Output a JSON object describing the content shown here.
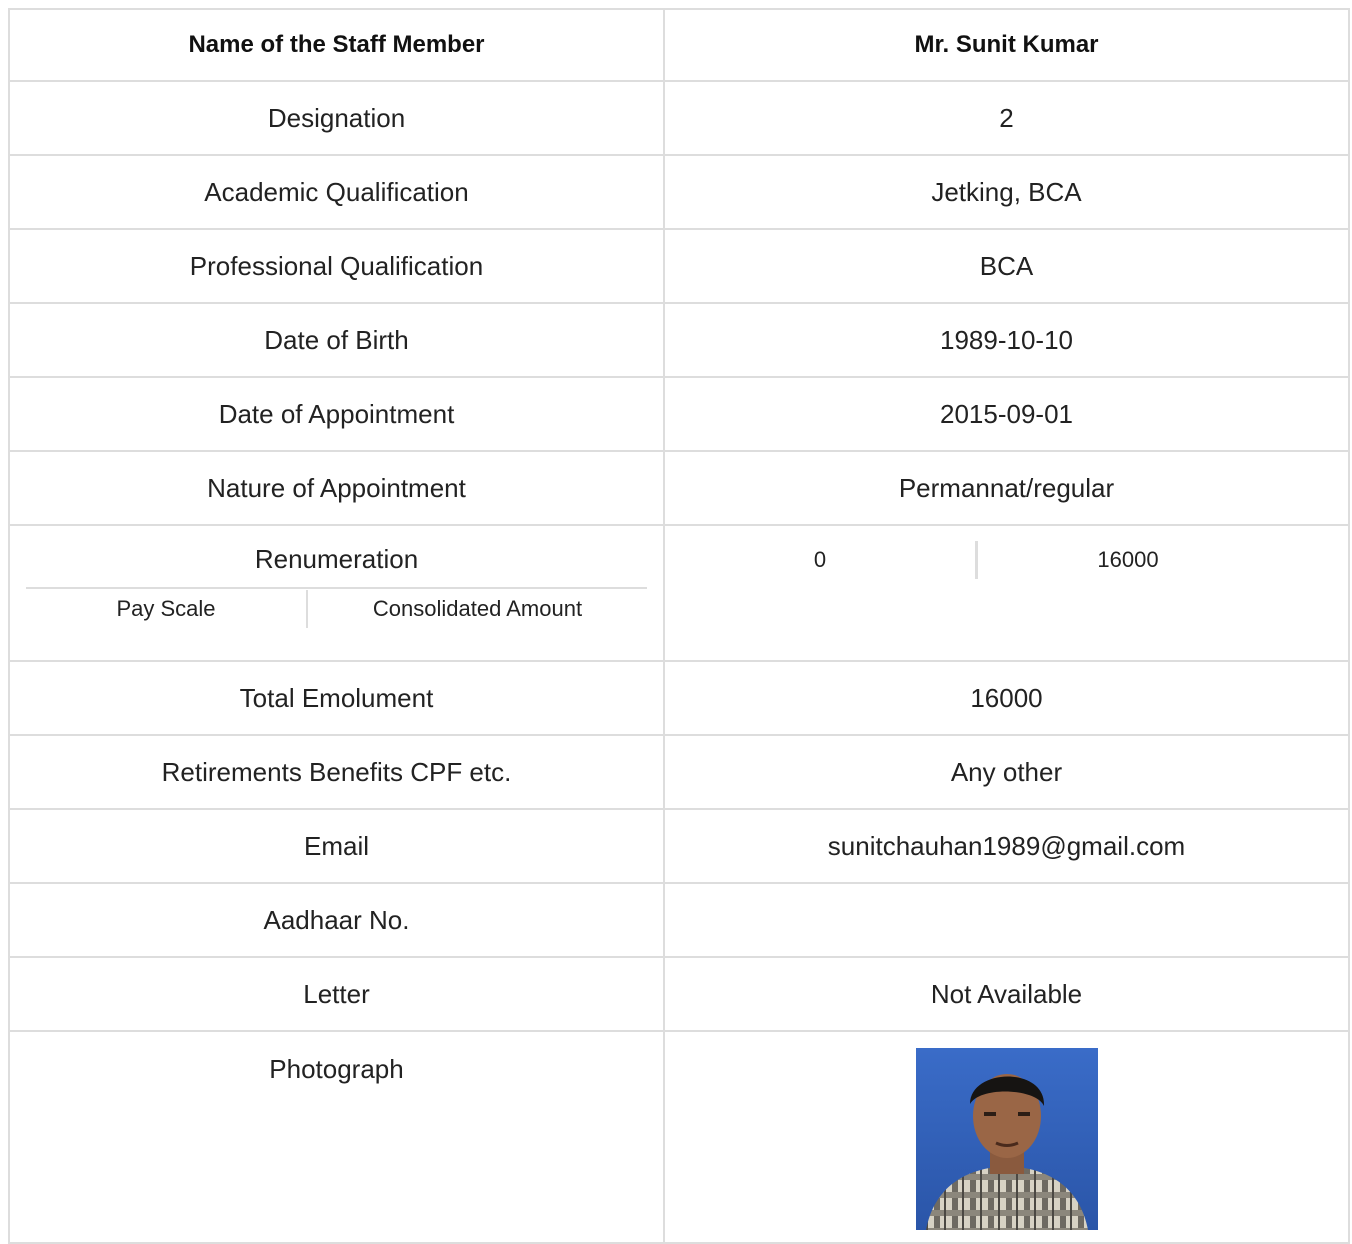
{
  "header": {
    "label": "Name of the Staff Member",
    "value": "Mr. Sunit Kumar"
  },
  "rows": [
    {
      "label": "Designation",
      "value": "2"
    },
    {
      "label": "Academic Qualification",
      "value": "Jetking, BCA"
    },
    {
      "label": "Professional Qualification",
      "value": "BCA"
    },
    {
      "label": "Date of Birth",
      "value": "1989-10-10"
    },
    {
      "label": "Date of Appointment",
      "value": "2015-09-01"
    },
    {
      "label": "Nature of Appointment",
      "value": "Permannat/regular"
    }
  ],
  "remuneration": {
    "label": "Renumeration",
    "pay_scale_label": "Pay Scale",
    "consolidated_label": "Consolidated Amount",
    "pay_scale_value": "0",
    "consolidated_value": "16000"
  },
  "rows2": [
    {
      "label": "Total Emolument",
      "value": "16000"
    },
    {
      "label": "Retirements Benefits CPF etc.",
      "value": "Any other"
    },
    {
      "label": "Email",
      "value": "sunitchauhan1989@gmail.com"
    },
    {
      "label": "Aadhaar No.",
      "value": ""
    },
    {
      "label": "Letter",
      "value": "Not Available"
    }
  ],
  "photo": {
    "label": "Photograph",
    "icon": "person-photo"
  }
}
